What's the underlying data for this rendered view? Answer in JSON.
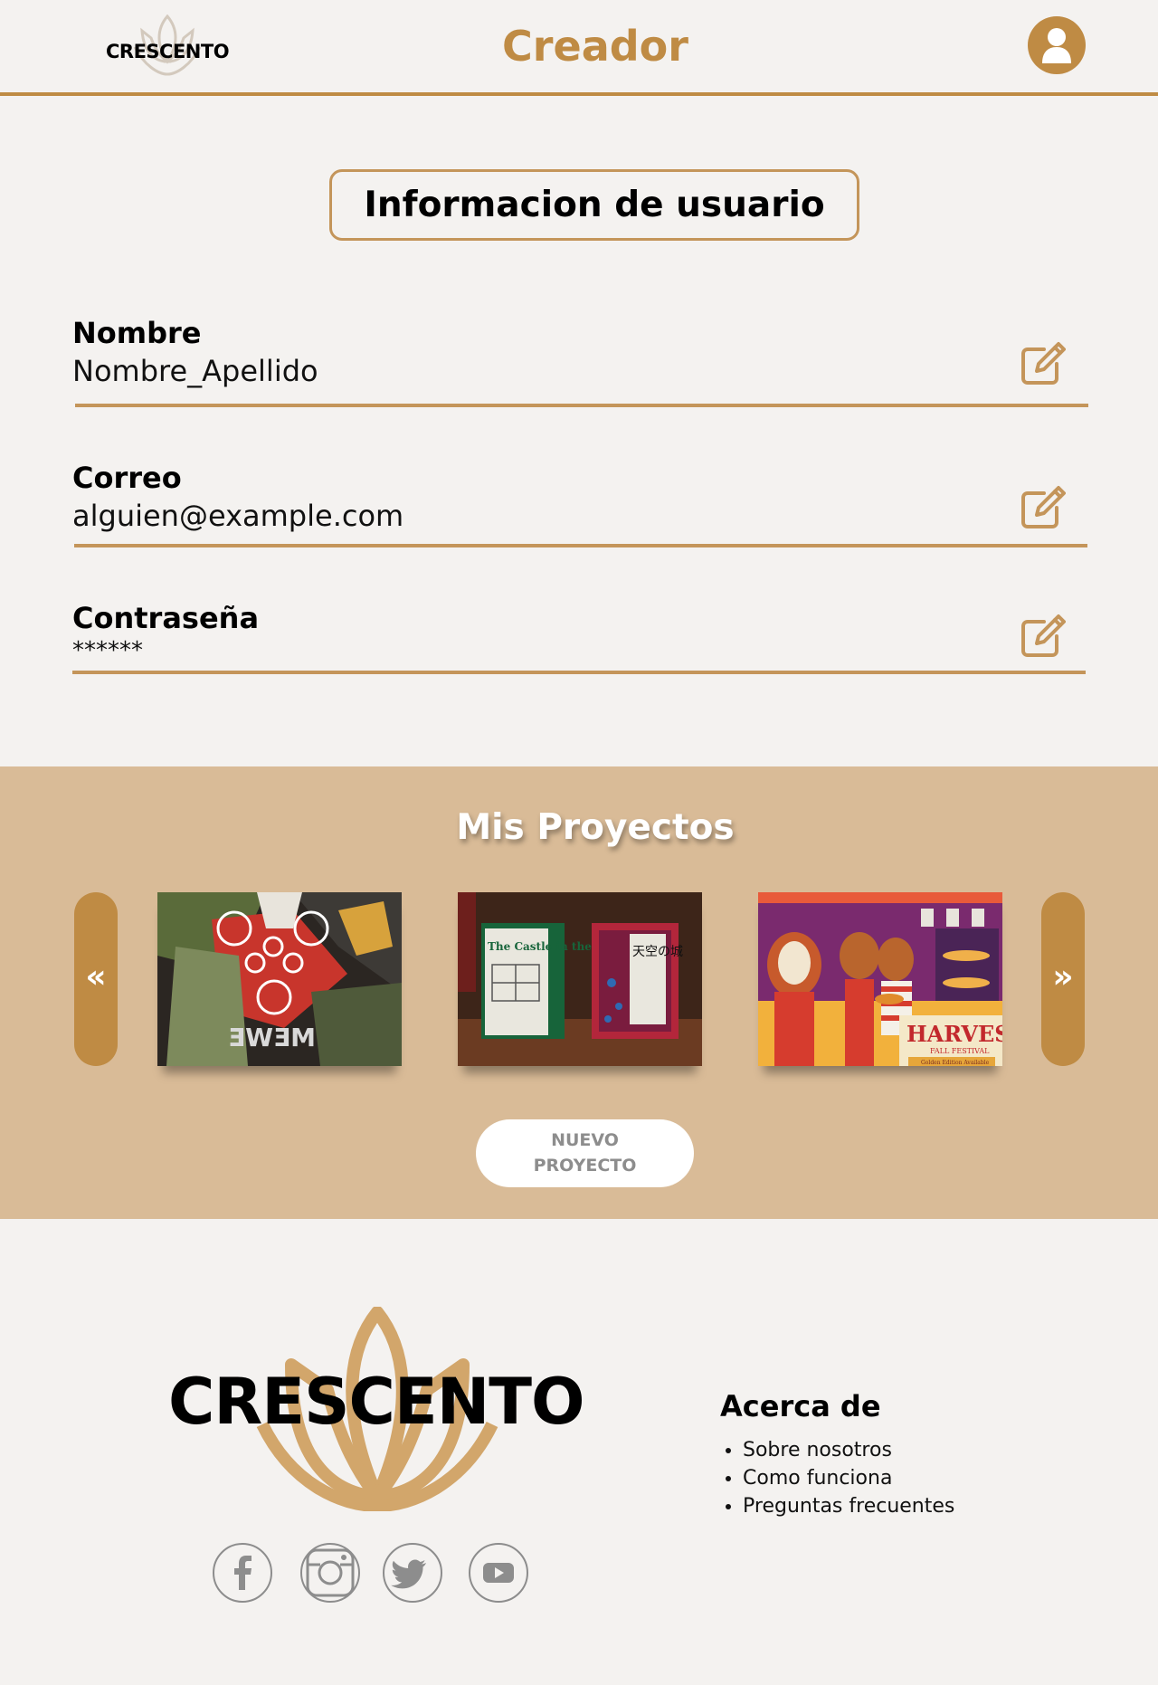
{
  "header": {
    "logo_text": "CRESCENTO",
    "title": "Creador",
    "user_icon": "user-icon"
  },
  "user_info": {
    "section_title": "Informacion de usuario",
    "fields": [
      {
        "label": "Nombre",
        "value": "Nombre_Apellido",
        "icon": "edit-icon"
      },
      {
        "label": "Correo",
        "value": "alguien@example.com",
        "icon": "edit-icon"
      },
      {
        "label": "Contraseña",
        "value": "******",
        "icon": "edit-icon"
      }
    ]
  },
  "projects": {
    "title": "Mis Proyectos",
    "prev_label": "«",
    "next_label": "»",
    "items": [
      {
        "art_text": "ƎWƎM"
      },
      {
        "art_text": "The Castle in the Sky",
        "art_text_2": "天空の城"
      },
      {
        "art_text": "HARVEST",
        "art_text_2": "FALL FESTIVAL",
        "art_text_3": "Golden Edition Available"
      }
    ],
    "new_button_line1": "NUEVO",
    "new_button_line2": "PROYECTO"
  },
  "footer": {
    "logo_text": "CRESCENTO",
    "social_icons": [
      "facebook-icon",
      "instagram-icon",
      "twitter-icon",
      "youtube-icon"
    ],
    "about_title": "Acerca de",
    "about_links": [
      "Sobre nosotros",
      "Como funciona",
      "Preguntas frecuentes"
    ]
  },
  "colors": {
    "accent": "#bf8b44",
    "accent_light": "#c4955a",
    "band": "#d9bb97",
    "background": "#f4f2f0"
  }
}
